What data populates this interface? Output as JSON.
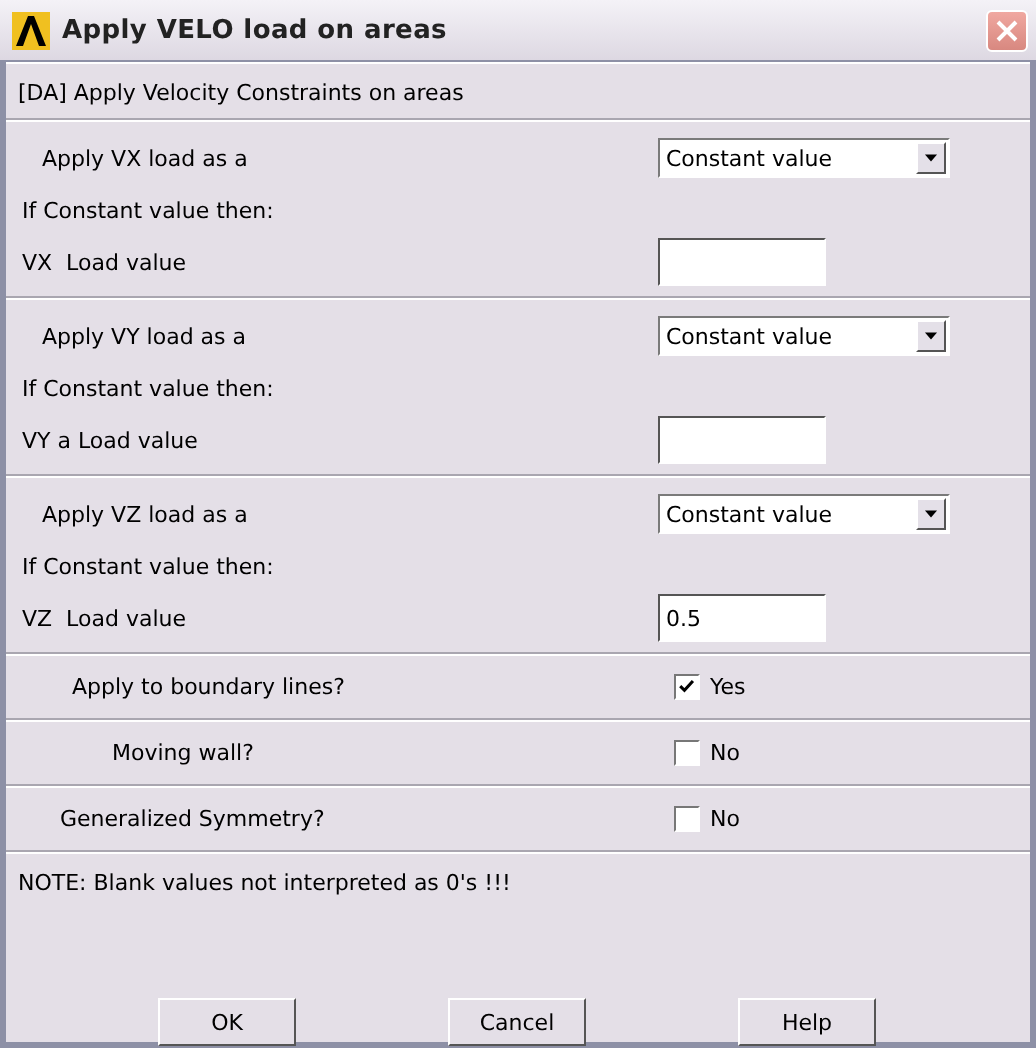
{
  "window": {
    "title": "Apply VELO load on areas"
  },
  "header": "[DA] Apply Velocity Constraints on areas",
  "load_sections": [
    {
      "apply_label": "Apply VX load as a",
      "dropdown": "Constant value",
      "condition_label": "If Constant value then:",
      "value_label": "VX  Load value"
    },
    {
      "apply_label": "Apply VY load as a",
      "dropdown": "Constant value",
      "condition_label": "If Constant value then:",
      "value_label": "VY a Load value"
    },
    {
      "apply_label": "Apply VZ load as a",
      "dropdown": "Constant value",
      "condition_label": "If Constant value then:",
      "value_label": "VZ  Load value",
      "value": "0.5"
    }
  ],
  "options": [
    {
      "label": "Apply to boundary lines?",
      "checked": true,
      "text": "Yes"
    },
    {
      "label": "Moving wall?",
      "checked": false,
      "text": "No"
    },
    {
      "label": "Generalized Symmetry?",
      "checked": false,
      "text": "No"
    }
  ],
  "note": "NOTE: Blank values not interpreted as 0's !!!",
  "buttons": [
    "OK",
    "Cancel",
    "Help"
  ]
}
